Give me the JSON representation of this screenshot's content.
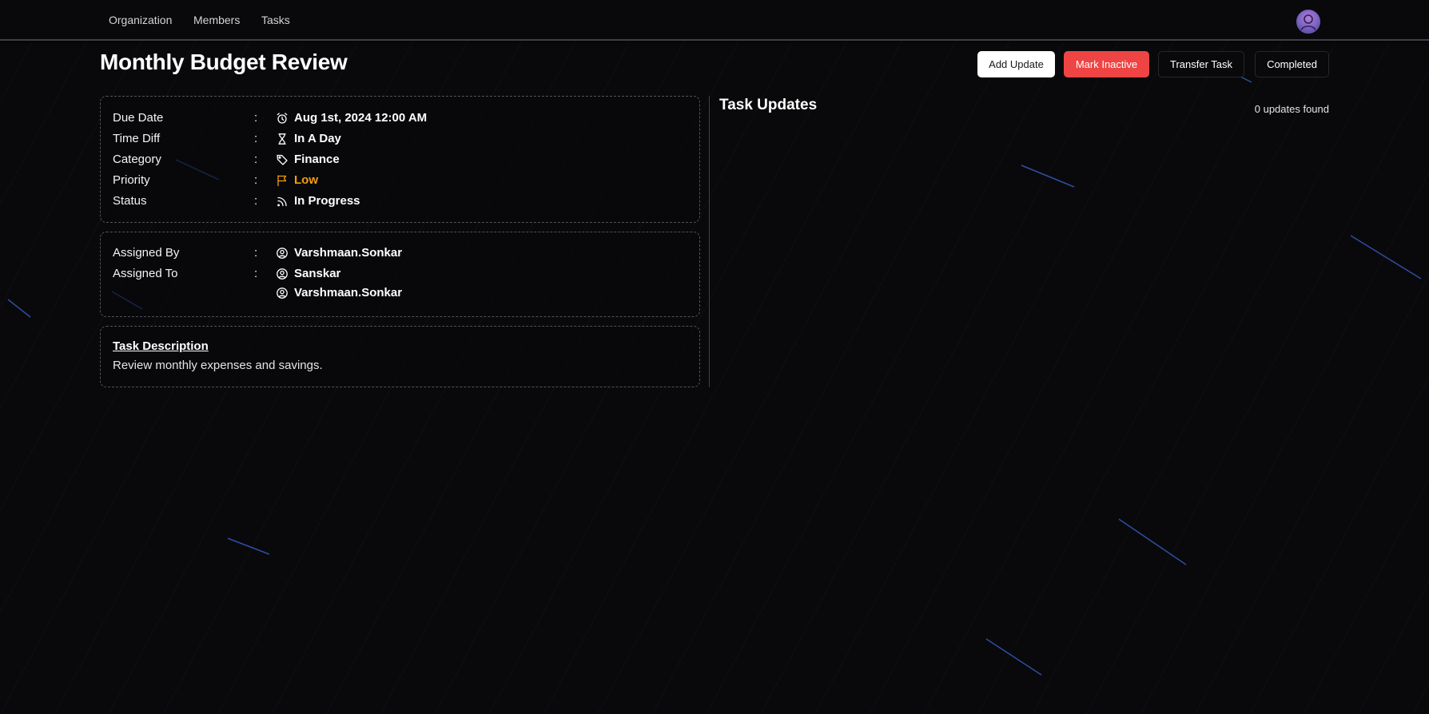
{
  "nav": {
    "links": [
      "Organization",
      "Members",
      "Tasks"
    ],
    "avatar_icon": "user-avatar-icon"
  },
  "task": {
    "title": "Monthly Budget Review",
    "actions": {
      "add_update": "Add Update",
      "mark_inactive": "Mark Inactive",
      "transfer_task": "Transfer Task",
      "completed": "Completed"
    },
    "details": {
      "due_date": {
        "label": "Due Date",
        "value": "Aug 1st, 2024 12:00 AM",
        "icon": "alarm-clock-icon"
      },
      "time_diff": {
        "label": "Time Diff",
        "value": "In A Day",
        "icon": "hourglass-icon"
      },
      "category": {
        "label": "Category",
        "value": "Finance",
        "icon": "tag-icon"
      },
      "priority": {
        "label": "Priority",
        "value": "Low",
        "icon": "flag-icon",
        "color": "#f59e0b"
      },
      "status": {
        "label": "Status",
        "value": "In Progress",
        "icon": "rss-icon"
      }
    },
    "assignment": {
      "assigned_by_label": "Assigned By",
      "assigned_by": "Varshmaan.Sonkar",
      "assigned_to_label": "Assigned To",
      "assigned_to": [
        "Sanskar",
        "Varshmaan.Sonkar"
      ],
      "person_icon": "user-circle-icon"
    },
    "description": {
      "heading": "Task Description",
      "text": "Review monthly expenses and savings."
    },
    "colon": ":"
  },
  "updates": {
    "heading": "Task Updates",
    "count_text": "0 updates found"
  },
  "colors": {
    "background": "#09090b",
    "danger": "#ef4444",
    "warning": "#f59e0b",
    "primary_button": "#ffffff"
  }
}
